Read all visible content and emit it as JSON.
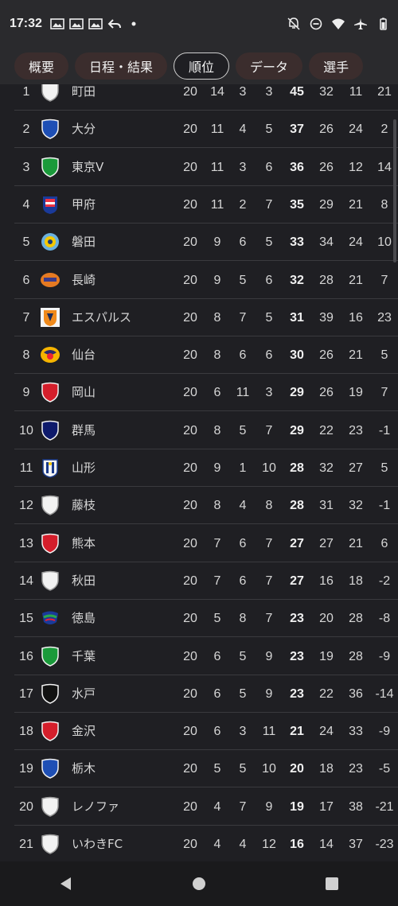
{
  "status": {
    "time": "17:32"
  },
  "tabs": [
    {
      "label": "概要",
      "active": false
    },
    {
      "label": "日程・結果",
      "active": false
    },
    {
      "label": "順位",
      "active": true
    },
    {
      "label": "データ",
      "active": false
    },
    {
      "label": "選手",
      "active": false
    }
  ],
  "standings": [
    {
      "rank": "1",
      "team": "町田",
      "crest": "shield-white",
      "p": "20",
      "w": "14",
      "d": "3",
      "l": "3",
      "pts": "45",
      "gf": "32",
      "ga": "11",
      "gd": "21"
    },
    {
      "rank": "2",
      "team": "大分",
      "crest": "shield-blue",
      "p": "20",
      "w": "11",
      "d": "4",
      "l": "5",
      "pts": "37",
      "gf": "26",
      "ga": "24",
      "gd": "2"
    },
    {
      "rank": "3",
      "team": "東京V",
      "crest": "shield-green",
      "p": "20",
      "w": "11",
      "d": "3",
      "l": "6",
      "pts": "36",
      "gf": "26",
      "ga": "12",
      "gd": "14"
    },
    {
      "rank": "4",
      "team": "甲府",
      "crest": "badge-kofu",
      "p": "20",
      "w": "11",
      "d": "2",
      "l": "7",
      "pts": "35",
      "gf": "29",
      "ga": "21",
      "gd": "8"
    },
    {
      "rank": "5",
      "team": "磐田",
      "crest": "badge-iwata",
      "p": "20",
      "w": "9",
      "d": "6",
      "l": "5",
      "pts": "33",
      "gf": "34",
      "ga": "24",
      "gd": "10"
    },
    {
      "rank": "6",
      "team": "長崎",
      "crest": "badge-nagasaki",
      "p": "20",
      "w": "9",
      "d": "5",
      "l": "6",
      "pts": "32",
      "gf": "28",
      "ga": "21",
      "gd": "7"
    },
    {
      "rank": "7",
      "team": "エスパルス",
      "crest": "badge-shimizu",
      "p": "20",
      "w": "8",
      "d": "7",
      "l": "5",
      "pts": "31",
      "gf": "39",
      "ga": "16",
      "gd": "23"
    },
    {
      "rank": "8",
      "team": "仙台",
      "crest": "badge-sendai",
      "p": "20",
      "w": "8",
      "d": "6",
      "l": "6",
      "pts": "30",
      "gf": "26",
      "ga": "21",
      "gd": "5"
    },
    {
      "rank": "9",
      "team": "岡山",
      "crest": "shield-red",
      "p": "20",
      "w": "6",
      "d": "11",
      "l": "3",
      "pts": "29",
      "gf": "26",
      "ga": "19",
      "gd": "7"
    },
    {
      "rank": "10",
      "team": "群馬",
      "crest": "shield-navy",
      "p": "20",
      "w": "8",
      "d": "5",
      "l": "7",
      "pts": "29",
      "gf": "22",
      "ga": "23",
      "gd": "-1"
    },
    {
      "rank": "11",
      "team": "山形",
      "crest": "badge-yamagata",
      "p": "20",
      "w": "9",
      "d": "1",
      "l": "10",
      "pts": "28",
      "gf": "32",
      "ga": "27",
      "gd": "5"
    },
    {
      "rank": "12",
      "team": "藤枝",
      "crest": "shield-white",
      "p": "20",
      "w": "8",
      "d": "4",
      "l": "8",
      "pts": "28",
      "gf": "31",
      "ga": "32",
      "gd": "-1"
    },
    {
      "rank": "13",
      "team": "熊本",
      "crest": "shield-red",
      "p": "20",
      "w": "7",
      "d": "6",
      "l": "7",
      "pts": "27",
      "gf": "27",
      "ga": "21",
      "gd": "6"
    },
    {
      "rank": "14",
      "team": "秋田",
      "crest": "shield-white",
      "p": "20",
      "w": "7",
      "d": "6",
      "l": "7",
      "pts": "27",
      "gf": "16",
      "ga": "18",
      "gd": "-2"
    },
    {
      "rank": "15",
      "team": "徳島",
      "crest": "badge-tokushima",
      "p": "20",
      "w": "5",
      "d": "8",
      "l": "7",
      "pts": "23",
      "gf": "20",
      "ga": "28",
      "gd": "-8"
    },
    {
      "rank": "16",
      "team": "千葉",
      "crest": "shield-green",
      "p": "20",
      "w": "6",
      "d": "5",
      "l": "9",
      "pts": "23",
      "gf": "19",
      "ga": "28",
      "gd": "-9"
    },
    {
      "rank": "17",
      "team": "水戸",
      "crest": "shield-black",
      "p": "20",
      "w": "6",
      "d": "5",
      "l": "9",
      "pts": "23",
      "gf": "22",
      "ga": "36",
      "gd": "-14"
    },
    {
      "rank": "18",
      "team": "金沢",
      "crest": "shield-red",
      "p": "20",
      "w": "6",
      "d": "3",
      "l": "11",
      "pts": "21",
      "gf": "24",
      "ga": "33",
      "gd": "-9"
    },
    {
      "rank": "19",
      "team": "栃木",
      "crest": "shield-blue",
      "p": "20",
      "w": "5",
      "d": "5",
      "l": "10",
      "pts": "20",
      "gf": "18",
      "ga": "23",
      "gd": "-5"
    },
    {
      "rank": "20",
      "team": "レノファ",
      "crest": "shield-white",
      "p": "20",
      "w": "4",
      "d": "7",
      "l": "9",
      "pts": "19",
      "gf": "17",
      "ga": "38",
      "gd": "-21"
    },
    {
      "rank": "21",
      "team": "いわきFC",
      "crest": "shield-white",
      "p": "20",
      "w": "4",
      "d": "4",
      "l": "12",
      "pts": "16",
      "gf": "14",
      "ga": "37",
      "gd": "-23"
    }
  ],
  "colors": {
    "background": "#1f1f23",
    "tab_bg": "#3b2d2d",
    "divider": "#3a3a3e"
  }
}
